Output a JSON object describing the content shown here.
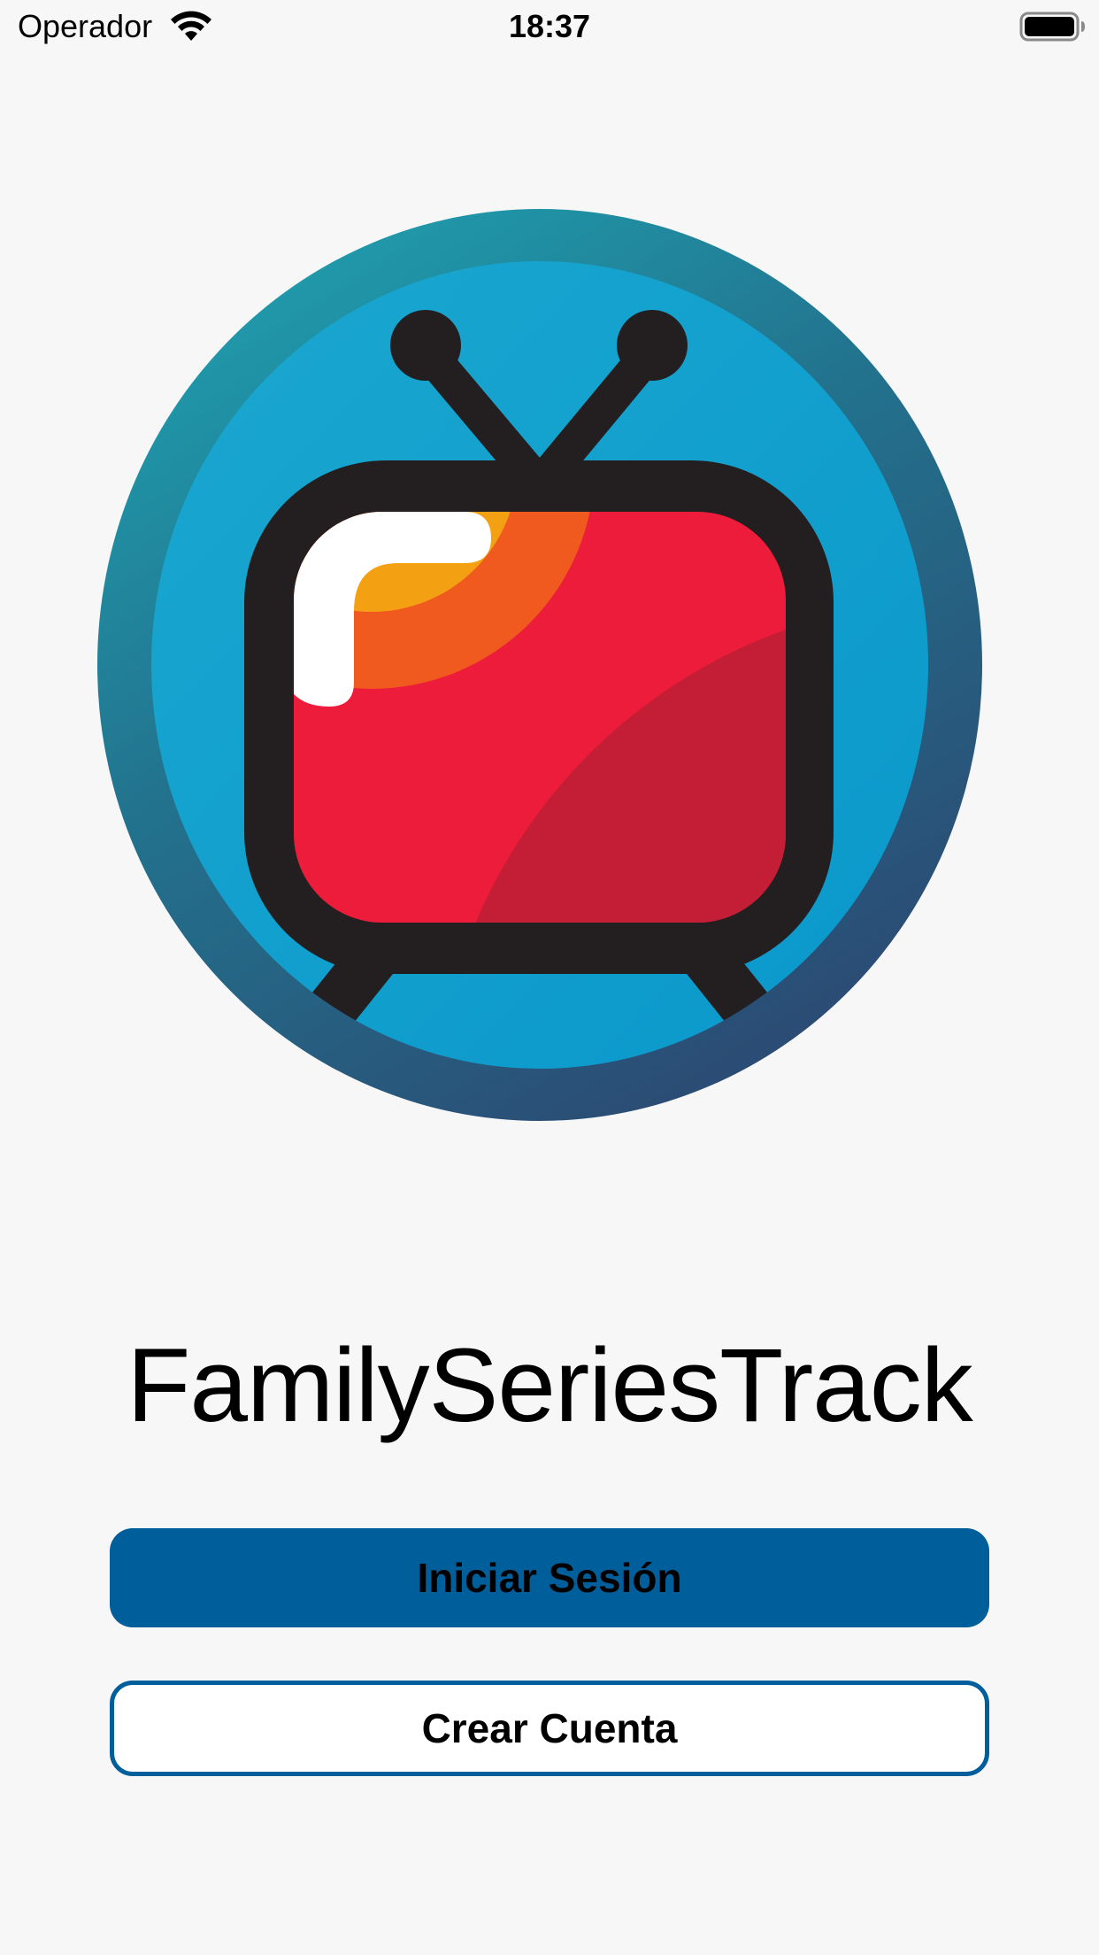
{
  "status_bar": {
    "carrier": "Operador",
    "time": "18:37",
    "wifi_icon": "wifi-icon",
    "battery_icon": "battery-full-icon"
  },
  "logo": {
    "icon": "retro-tv-icon",
    "ring_color_top": "#1fa3b3",
    "ring_color_bottom": "#2b4e75",
    "inner_color": "#1aa6d4",
    "frame_color": "#231f20",
    "screen_colors": [
      "#f4a013",
      "#f05a1e",
      "#ec1c3a",
      "#c41e36",
      "#ffffff"
    ]
  },
  "app": {
    "title": "FamilySeriesTrack"
  },
  "actions": {
    "login_label": "Iniciar Sesión",
    "register_label": "Crear Cuenta"
  },
  "colors": {
    "background": "#f7f7f7",
    "accent": "#005e9a"
  }
}
